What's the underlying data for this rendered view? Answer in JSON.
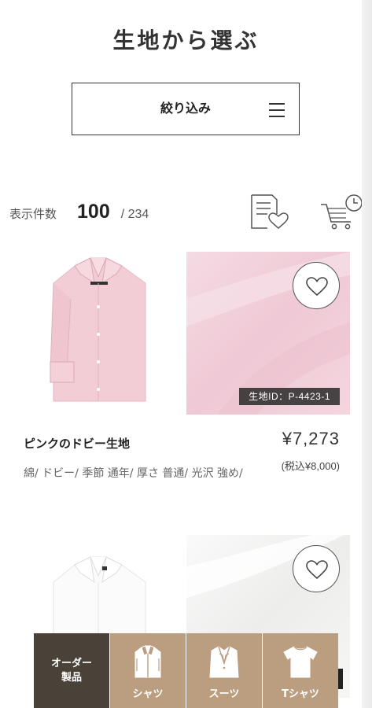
{
  "page": {
    "title": "生地から選ぶ"
  },
  "filter": {
    "label": "絞り込み",
    "icon": "hamburger-icon"
  },
  "count": {
    "label": "表示件数",
    "shown": "100",
    "total": "/ 234"
  },
  "header_icons": {
    "favorites": "favorite-list-icon",
    "history": "cart-history-icon"
  },
  "products": [
    {
      "name": "ピンクのドビー生地",
      "price": "¥7,273",
      "tax_price": "(税込¥8,000)",
      "fabric_id": "生地ID：P-4423-1",
      "tags": "綿/ ドビー/ 季節 通年/ 厚さ 普通/ 光沢 強め/",
      "shirt_color": "#f2cdd5",
      "fabric_color": "#f3d2dc"
    },
    {
      "shirt_color": "#fbfbfb",
      "fabric_color": "#f5f5f4"
    }
  ],
  "bottom_nav": {
    "order_label_line1": "オーダー",
    "order_label_line2": "製品",
    "items": [
      {
        "label": "シャツ",
        "icon": "shirt-icon"
      },
      {
        "label": "スーツ",
        "icon": "suit-icon"
      },
      {
        "label": "Tシャツ",
        "icon": "tshirt-icon"
      }
    ]
  },
  "colors": {
    "accent": "#bb9e80",
    "dark": "#4a4238"
  }
}
